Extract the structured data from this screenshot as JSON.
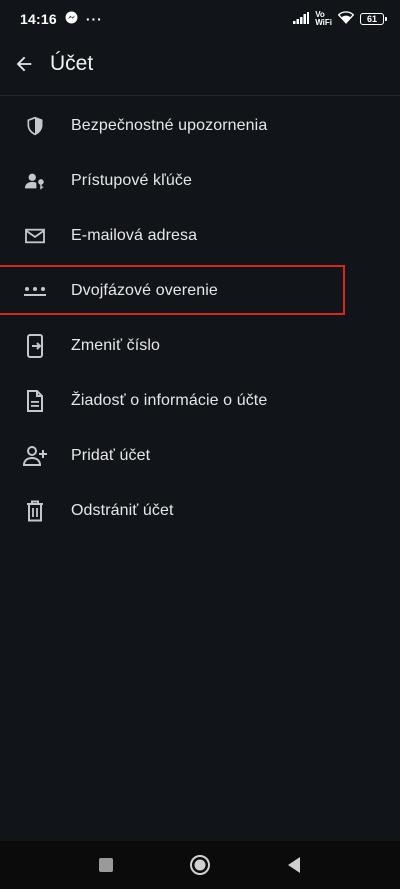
{
  "status_bar": {
    "time": "14:16",
    "more": "···",
    "volte_top": "Vo",
    "volte_bottom": "WiFi",
    "battery": "61"
  },
  "header": {
    "title": "Účet"
  },
  "menu": {
    "items": [
      {
        "label": "Bezpečnostné upozornenia",
        "icon": "shield-icon"
      },
      {
        "label": "Prístupové kľúče",
        "icon": "person-key-icon"
      },
      {
        "label": "E-mailová adresa",
        "icon": "mail-icon"
      },
      {
        "label": "Dvojfázové overenie",
        "icon": "dots-icon"
      },
      {
        "label": "Zmeniť číslo",
        "icon": "phone-transfer-icon"
      },
      {
        "label": "Žiadosť o informácie o účte",
        "icon": "document-icon"
      },
      {
        "label": "Pridať účet",
        "icon": "person-add-icon"
      },
      {
        "label": "Odstrániť účet",
        "icon": "trash-icon"
      }
    ],
    "highlight_color": "#d7261e"
  },
  "colors": {
    "background": "#111418",
    "text": "#e6e7ea",
    "icon": "#c4c7cc"
  }
}
